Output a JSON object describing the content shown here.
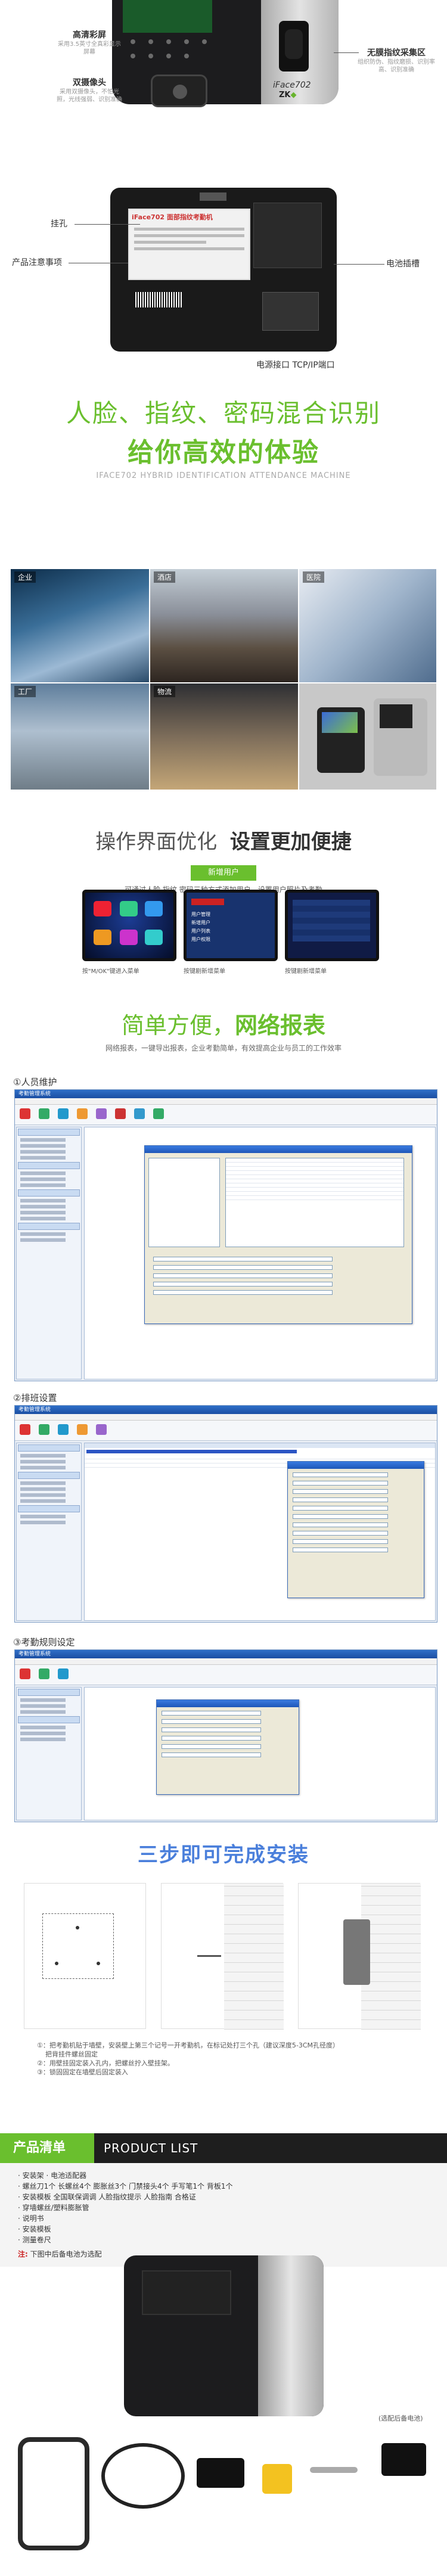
{
  "device": {
    "brand": "iFace702",
    "logo": "ZK",
    "callouts": {
      "screen_title": "高清彩屏",
      "screen_desc": "采用3.5英寸全真彩显示屏幕",
      "camera_title": "双摄像头",
      "camera_desc": "采用双摄像头，不怕光照，光线强弱、识别准确",
      "fingerprint_title": "无膜指纹采集区",
      "fingerprint_desc": "组织防伪、指纹磨损、识别率高、识别准确",
      "hanger": "挂孔",
      "product_note": "产品注意事项",
      "battery": "电池插槽",
      "ports": "电源接口 TCP/IP端口"
    },
    "back_label": "iFace702 面部指纹考勤机"
  },
  "hero": {
    "line1": "人脸、指纹、密码混合识别",
    "line2": "给你高效的体验",
    "en": "IFACE702 HYBRID IDENTIFICATION ATTENDANCE MACHINE"
  },
  "scenes": [
    "企业",
    "酒店",
    "医院",
    "工厂",
    "物流"
  ],
  "ui_section": {
    "title_a": "操作界面优化",
    "title_b": "设置更加便捷",
    "pill": "新增用户",
    "sub": "可通过人脸 指纹 密码三种方式添加用户，设置用户照片及考勤",
    "caps": [
      "按\"M/OK\"键进入菜单",
      "按键剧新增菜单",
      "按键剧新增菜单"
    ],
    "menu_items": [
      "用户管理",
      "新增用户",
      "用户列表",
      "用户权限"
    ]
  },
  "report": {
    "title_a": "简单方便，",
    "title_b": "网络报表",
    "sub": "网络报表，一键导出报表，企业考勤简单，有效提高企业与员工的工作效率"
  },
  "windows": [
    {
      "label": "①人员维护",
      "title": "考勤管理系统"
    },
    {
      "label": "②排班设置",
      "title": "考勤管理系统"
    },
    {
      "label": "③考勤规则设定",
      "title": "考勤管理系统"
    }
  ],
  "install": {
    "title": "三步即可完成安装",
    "steps": [
      "①：把考勤机贴于墙壁，安装壁上第三个记号一开考勤机，在标记处打三个孔（建议深度5-3CM孔径度）",
      "把背挂件螺丝固定",
      "②：用壁挂固定装入孔内，把螺丝拧入壁挂架。",
      "③：锁固固定在墙壁后固定装入"
    ]
  },
  "products": {
    "title_cn": "产品清单",
    "title_en": "PRODUCT LIST",
    "items": [
      "· 安装架      · 电池适配器",
      "· 螺丝刀1个  长螺丝4个  膨胀丝3个  门禁接头4个  手写笔1个  背板1个",
      "· 安装模板  全国联保调调  人脸指纹提示  人脸指南  合格证",
      "· 穿墙螺丝/塑料膨胀管",
      "· 说明书",
      "· 安装模板",
      "· 测量卷尺"
    ],
    "note_label": "注:",
    "note": "下图中后备电池为选配",
    "battery_caption": "(选配后备电池)"
  },
  "colors": {
    "green": "#6abf2e",
    "blue": "#4a7fdb",
    "dark": "#1e1e1e"
  }
}
